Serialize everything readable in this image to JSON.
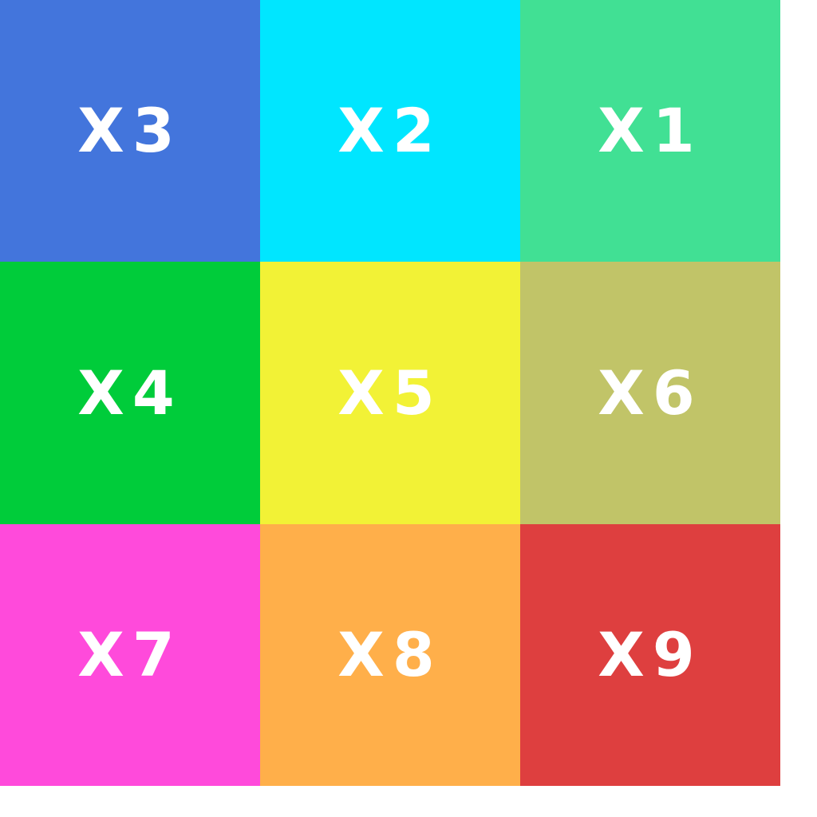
{
  "tiles": [
    {
      "label": "X3",
      "color": "#4375dc"
    },
    {
      "label": "X2",
      "color": "#00e6ff"
    },
    {
      "label": "X1",
      "color": "#41e094"
    },
    {
      "label": "X4",
      "color": "#00cc3a"
    },
    {
      "label": "X5",
      "color": "#f2f236"
    },
    {
      "label": "X6",
      "color": "#c1c468"
    },
    {
      "label": "X7",
      "color": "#ff4adb"
    },
    {
      "label": "X8",
      "color": "#ffaf4a"
    },
    {
      "label": "X9",
      "color": "#de3f3f"
    }
  ]
}
